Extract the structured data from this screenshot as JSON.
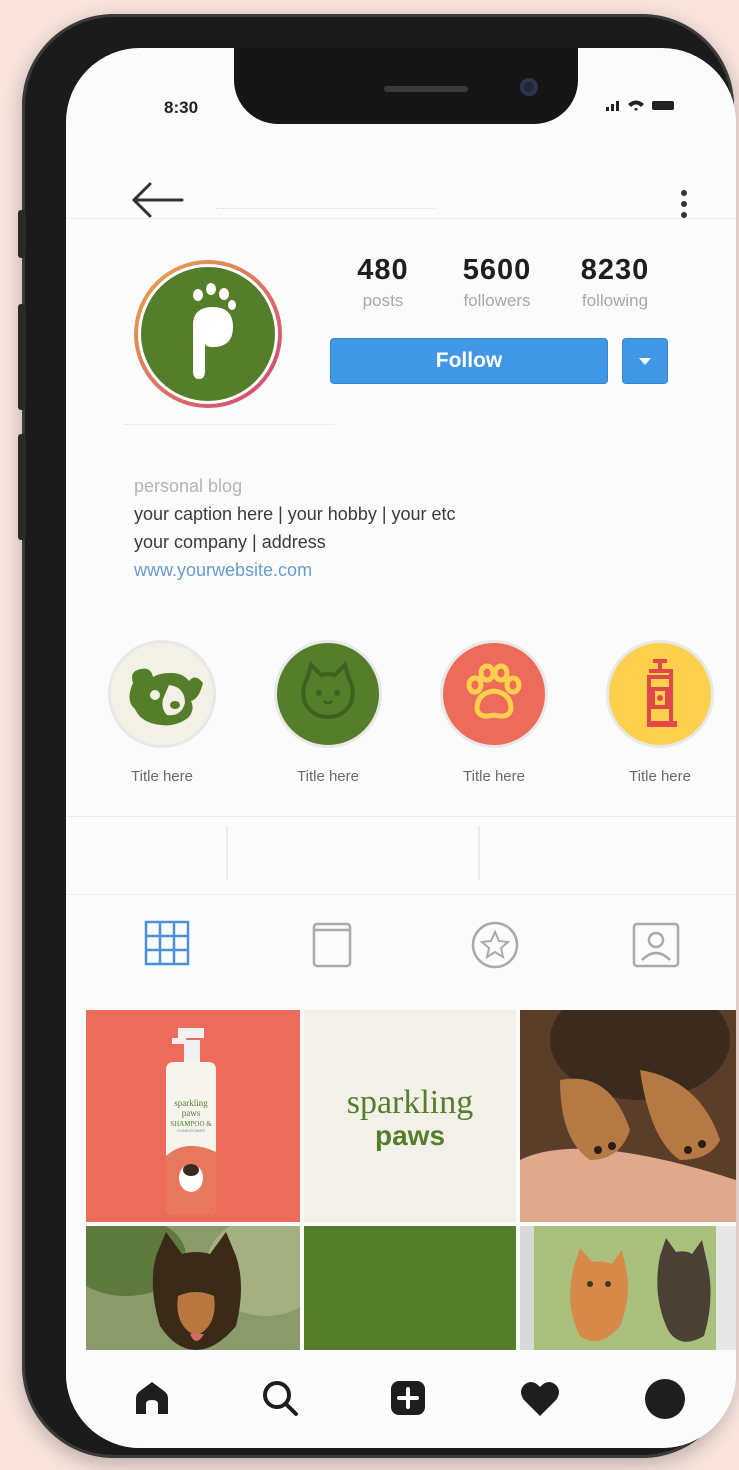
{
  "status_bar": {
    "time": "8:30",
    "icons": "signal wifi battery"
  },
  "profile": {
    "stats": [
      {
        "value": "480",
        "label": "posts"
      },
      {
        "value": "5600",
        "label": "followers"
      },
      {
        "value": "8230",
        "label": "following"
      }
    ],
    "follow_label": "Follow",
    "bio": {
      "category": "personal blog",
      "line1": "your caption here  | your hobby | your etc",
      "line2": "your company | address",
      "website": "www.yourwebsite.com"
    }
  },
  "highlights": [
    {
      "title": "Title here",
      "icon": "dog-icon",
      "bg": "#f3f1e6"
    },
    {
      "title": "Title here",
      "icon": "cat-icon",
      "bg": "#557e2b"
    },
    {
      "title": "Title here",
      "icon": "paw-icon",
      "bg": "#ec6b5b"
    },
    {
      "title": "Title here",
      "icon": "shampoo-icon",
      "bg": "#fcd04d"
    }
  ],
  "tabs": [
    "grid-icon",
    "tv-icon",
    "star-icon",
    "tagged-icon"
  ],
  "posts": {
    "shampoo_brand": "sparkling\npaws",
    "shampoo_text": "SHAMPOO &",
    "shampoo_sub": "CONDITIONER",
    "logo_line1": "sparkling",
    "logo_line2": "paws"
  },
  "bottom_nav": [
    "home-icon",
    "search-icon",
    "add-icon",
    "heart-icon",
    "profile-icon"
  ],
  "colors": {
    "brand_green": "#557e2b",
    "follow_blue": "#3f97e6",
    "coral": "#ec6b5b",
    "yellow": "#fcd04d"
  }
}
